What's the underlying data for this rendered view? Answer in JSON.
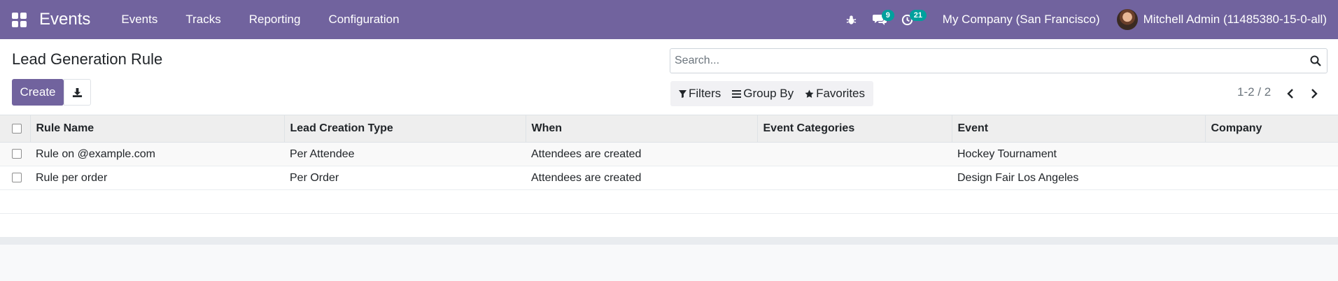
{
  "navbar": {
    "brand": "Events",
    "menu": [
      "Events",
      "Tracks",
      "Reporting",
      "Configuration"
    ],
    "messages_count": "9",
    "activities_count": "21",
    "company": "My Company (San Francisco)",
    "user": "Mitchell Admin (11485380-15-0-all)",
    "icons": [
      "apps-grid-icon",
      "bug-icon",
      "chat-icon",
      "clock-icon"
    ]
  },
  "control_panel": {
    "title": "Lead Generation Rule",
    "create_label": "Create",
    "search_placeholder": "Search...",
    "filters_label": "Filters",
    "groupby_label": "Group By",
    "favorites_label": "Favorites",
    "pager": "1-2 / 2"
  },
  "table": {
    "columns": [
      "Rule Name",
      "Lead Creation Type",
      "When",
      "Event Categories",
      "Event",
      "Company"
    ],
    "rows": [
      [
        "Rule on @example.com",
        "Per Attendee",
        "Attendees are created",
        "",
        "Hockey Tournament",
        ""
      ],
      [
        "Rule per order",
        "Per Order",
        "Attendees are created",
        "",
        "Design Fair Los Angeles",
        ""
      ]
    ]
  },
  "colors": {
    "brand": "#71639e",
    "badge": "#00a09d",
    "header_bg": "#eeeeee"
  }
}
